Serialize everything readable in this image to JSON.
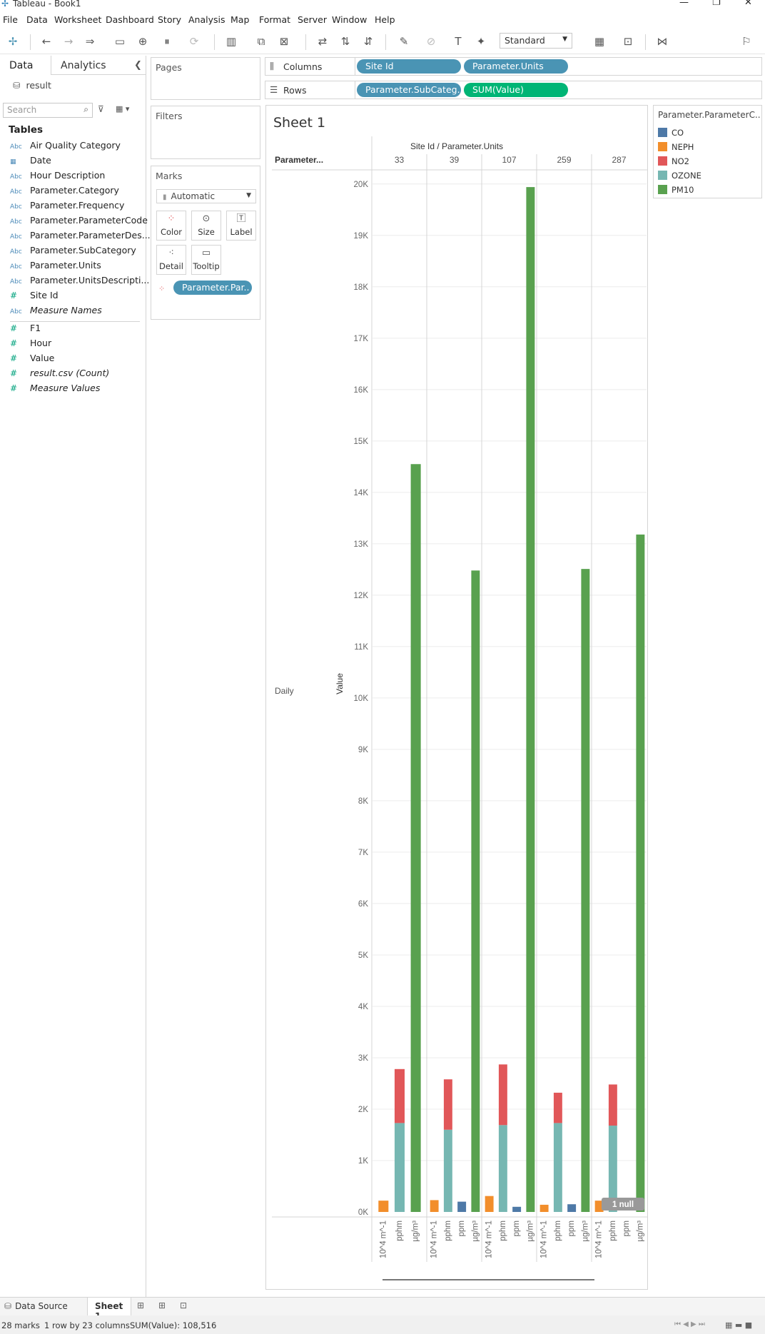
{
  "window": {
    "title": "Tableau - Book1"
  },
  "menu": [
    "File",
    "Data",
    "Worksheet",
    "Dashboard",
    "Story",
    "Analysis",
    "Map",
    "Format",
    "Server",
    "Window",
    "Help"
  ],
  "toolbar": {
    "fit_select": "Standard"
  },
  "data_pane": {
    "tab_data": "Data",
    "tab_analytics": "Analytics",
    "datasource": "result",
    "search_placeholder": "Search",
    "tables_header": "Tables",
    "dimensions": [
      {
        "type": "Abc",
        "name": "Air Quality Category"
      },
      {
        "type": "date",
        "name": "Date"
      },
      {
        "type": "Abc",
        "name": "Hour Description"
      },
      {
        "type": "Abc",
        "name": "Parameter.Category"
      },
      {
        "type": "Abc",
        "name": "Parameter.Frequency"
      },
      {
        "type": "Abc",
        "name": "Parameter.ParameterCode"
      },
      {
        "type": "Abc",
        "name": "Parameter.ParameterDes..."
      },
      {
        "type": "Abc",
        "name": "Parameter.SubCategory"
      },
      {
        "type": "Abc",
        "name": "Parameter.Units"
      },
      {
        "type": "Abc",
        "name": "Parameter.UnitsDescripti..."
      },
      {
        "type": "#",
        "name": "Site Id"
      },
      {
        "type": "Abc",
        "name": "Measure Names",
        "italic": true
      }
    ],
    "measures": [
      {
        "type": "#",
        "name": "F1"
      },
      {
        "type": "#",
        "name": "Hour"
      },
      {
        "type": "#",
        "name": "Value"
      },
      {
        "type": "#",
        "name": "result.csv (Count)",
        "italic": true
      },
      {
        "type": "#",
        "name": "Measure Values",
        "italic": true
      }
    ]
  },
  "shelves": {
    "pages_label": "Pages",
    "filters_label": "Filters",
    "marks_label": "Marks",
    "marks_type": "Automatic",
    "marks_buttons": [
      "Color",
      "Size",
      "Label",
      "Detail",
      "Tooltip"
    ],
    "marks_pill": "Parameter.Par..",
    "columns_label": "Columns",
    "rows_label": "Rows",
    "columns_pills": [
      "Site Id",
      "Parameter.Units"
    ],
    "rows_pills": [
      "Parameter.SubCateg..",
      "SUM(Value)"
    ]
  },
  "sheet": {
    "title": "Sheet 1",
    "column_header": "Site Id / Parameter.Units",
    "row_header": "Parameter...",
    "row_value": "Daily",
    "axis_title": "Value",
    "null_badge": "1 null"
  },
  "chart_data": {
    "type": "bar",
    "stacked": true,
    "groups": [
      "33",
      "39",
      "107",
      "259",
      "287"
    ],
    "units": [
      "10^4 m^-1",
      "pphm",
      "µg/m³",
      "ppm"
    ],
    "y_ticks": [
      "0K",
      "1K",
      "2K",
      "3K",
      "4K",
      "5K",
      "6K",
      "7K",
      "8K",
      "9K",
      "10K",
      "11K",
      "12K",
      "13K",
      "14K",
      "15K",
      "16K",
      "17K",
      "18K",
      "19K",
      "20K"
    ],
    "ylim": [
      0,
      20500
    ],
    "ylabel": "Value",
    "colors": {
      "CO": "#4e79a7",
      "NEPH": "#f28e2b",
      "NO2": "#e15759",
      "OZONE": "#76b7b2",
      "PM10": "#59a14f"
    },
    "legend_title": "Parameter.ParameterC..",
    "legend": [
      "CO",
      "NEPH",
      "NO2",
      "OZONE",
      "PM10"
    ],
    "bars": [
      {
        "group": "33",
        "units": [
          "10^4 m^-1",
          "pphm",
          "µg/m³"
        ],
        "stacks": [
          [
            {
              "s": "NEPH",
              "v": 220
            }
          ],
          [
            {
              "s": "OZONE",
              "v": 1730
            },
            {
              "s": "NO2",
              "v": 1050
            }
          ],
          [
            {
              "s": "PM10",
              "v": 14550
            }
          ]
        ]
      },
      {
        "group": "39",
        "units": [
          "10^4 m^-1",
          "pphm",
          "ppm",
          "µg/m³"
        ],
        "stacks": [
          [
            {
              "s": "NEPH",
              "v": 230
            }
          ],
          [
            {
              "s": "OZONE",
              "v": 1600
            },
            {
              "s": "NO2",
              "v": 980
            }
          ],
          [
            {
              "s": "CO",
              "v": 200
            }
          ],
          [
            {
              "s": "PM10",
              "v": 12480
            }
          ]
        ]
      },
      {
        "group": "107",
        "units": [
          "10^4 m^-1",
          "pphm",
          "ppm",
          "µg/m³"
        ],
        "stacks": [
          [
            {
              "s": "NEPH",
              "v": 310
            }
          ],
          [
            {
              "s": "OZONE",
              "v": 1690
            },
            {
              "s": "NO2",
              "v": 1180
            }
          ],
          [
            {
              "s": "CO",
              "v": 100
            }
          ],
          [
            {
              "s": "PM10",
              "v": 19940
            }
          ]
        ]
      },
      {
        "group": "259",
        "units": [
          "10^4 m^-1",
          "pphm",
          "ppm",
          "µg/m³"
        ],
        "stacks": [
          [
            {
              "s": "NEPH",
              "v": 140
            }
          ],
          [
            {
              "s": "OZONE",
              "v": 1730
            },
            {
              "s": "NO2",
              "v": 590
            }
          ],
          [
            {
              "s": "CO",
              "v": 150
            }
          ],
          [
            {
              "s": "PM10",
              "v": 12510
            }
          ]
        ]
      },
      {
        "group": "287",
        "units": [
          "10^4 m^-1",
          "pphm",
          "ppm",
          "µg/m³"
        ],
        "stacks": [
          [
            {
              "s": "NEPH",
              "v": 220
            }
          ],
          [
            {
              "s": "OZONE",
              "v": 1680
            },
            {
              "s": "NO2",
              "v": 800
            }
          ],
          [],
          [
            {
              "s": "PM10",
              "v": 13180
            }
          ]
        ]
      }
    ]
  },
  "sheet_tabs": {
    "data_source": "Data Source",
    "active": "Sheet 1"
  },
  "status": {
    "marks": "28 marks",
    "dims": "1 row by 23 columns",
    "sum": "SUM(Value): 108,516"
  }
}
